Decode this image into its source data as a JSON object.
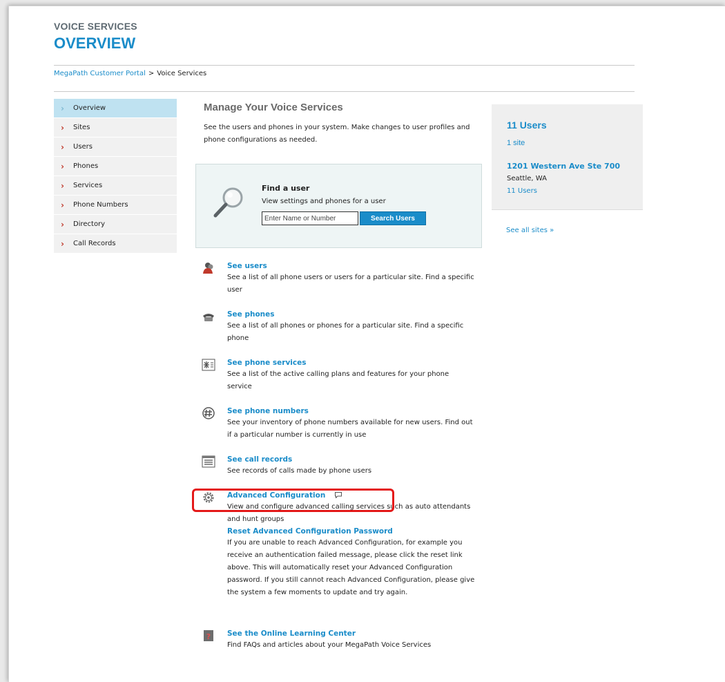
{
  "header": {
    "section": "VOICE SERVICES",
    "title": "OVERVIEW"
  },
  "breadcrumb": {
    "home": "MegaPath Customer Portal",
    "separator": ">",
    "current": "Voice Services"
  },
  "nav": {
    "items": [
      {
        "label": "Overview",
        "active": true
      },
      {
        "label": "Sites"
      },
      {
        "label": "Users"
      },
      {
        "label": "Phones"
      },
      {
        "label": "Services"
      },
      {
        "label": "Phone Numbers"
      },
      {
        "label": "Directory"
      },
      {
        "label": "Call Records"
      }
    ]
  },
  "main": {
    "heading": "Manage Your Voice Services",
    "intro": "See the users and phones in your system. Make changes to user profiles and phone configurations as needed.",
    "find": {
      "title": "Find a user",
      "description": "View settings and phones for a user",
      "placeholder": "Enter Name or Number",
      "button": "Search Users"
    },
    "links": [
      {
        "title": "See users",
        "icon": "users-icon",
        "description": "See a list of all phone users or users for a particular site. Find a specific user"
      },
      {
        "title": "See phones",
        "icon": "phone-icon",
        "description": "See a list of all phones or phones for a particular site. Find a specific phone"
      },
      {
        "title": "See phone services",
        "icon": "phone-services-icon",
        "description": "See a list of the active calling plans and features for your phone service"
      },
      {
        "title": "See phone numbers",
        "icon": "phone-numbers-icon",
        "description": "See your inventory of phone numbers available for new users. Find out if a particular number is currently in use"
      },
      {
        "title": "See call records",
        "icon": "call-records-icon",
        "description": "See records of calls made by phone users"
      },
      {
        "title": "Advanced Configuration",
        "icon": "gear-icon",
        "description": "View and configure advanced calling services such as auto attendants and hunt groups"
      },
      {
        "title": "See the Online Learning Center",
        "icon": "help-icon",
        "description": "Find FAQs and articles about your MegaPath Voice Services"
      }
    ],
    "reset": {
      "title": "Reset Advanced Configuration Password",
      "description": "If you are unable to reach Advanced Configuration, for example you receive an authentication failed message, please click the reset link above. This will automatically reset your Advanced Configuration password. If you still cannot reach Advanced Configuration, please give the system a few moments to update and try again."
    }
  },
  "side": {
    "users": "11 Users",
    "sites": "1 site",
    "address": "1201 Western Ave Ste 700",
    "city": "Seattle, WA",
    "site_users": "11 Users",
    "see_all": "See all sites »"
  },
  "colors": {
    "accent": "#1a8cc9",
    "nav_active": "#bfe2f1",
    "highlight": "#e41919"
  }
}
